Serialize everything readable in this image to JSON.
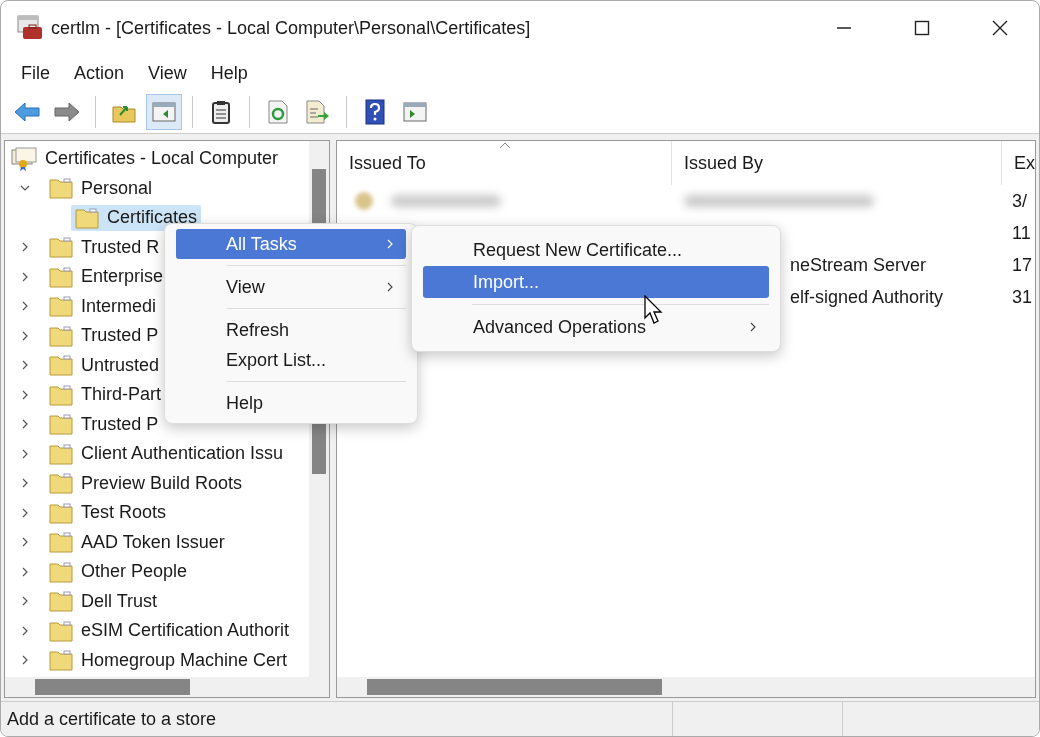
{
  "window": {
    "title": "certlm - [Certificates - Local Computer\\Personal\\Certificates]"
  },
  "menu_bar": [
    "File",
    "Action",
    "View",
    "Help"
  ],
  "toolbar": [
    [
      {
        "kind": "back",
        "pressed": false
      },
      {
        "kind": "forward",
        "pressed": false
      }
    ],
    [
      {
        "kind": "up",
        "pressed": false
      },
      {
        "kind": "tree",
        "pressed": true
      }
    ],
    [
      {
        "kind": "clipboard",
        "pressed": false
      }
    ],
    [
      {
        "kind": "refresh",
        "pressed": false
      },
      {
        "kind": "export",
        "pressed": false
      }
    ],
    [
      {
        "kind": "help",
        "pressed": false
      },
      {
        "kind": "actionpane",
        "pressed": false
      }
    ]
  ],
  "tree": {
    "root": "Certificates - Local Computer",
    "items": [
      {
        "label": "Personal",
        "expanded": true,
        "selected": false,
        "children": [
          {
            "label": "Certificates",
            "selected": true
          }
        ]
      },
      {
        "label": "Trusted R",
        "expanded": false,
        "selected": false
      },
      {
        "label": "Enterprise",
        "expanded": false,
        "selected": false
      },
      {
        "label": "Intermedi",
        "expanded": false,
        "selected": false
      },
      {
        "label": "Trusted P",
        "expanded": false,
        "selected": false
      },
      {
        "label": "Untrusted",
        "expanded": false,
        "selected": false
      },
      {
        "label": "Third-Part",
        "expanded": false,
        "selected": false
      },
      {
        "label": "Trusted P",
        "expanded": false,
        "selected": false
      },
      {
        "label": "Client Authentication Issu",
        "expanded": false,
        "selected": false
      },
      {
        "label": "Preview Build Roots",
        "expanded": false,
        "selected": false
      },
      {
        "label": "Test Roots",
        "expanded": false,
        "selected": false
      },
      {
        "label": "AAD Token Issuer",
        "expanded": false,
        "selected": false
      },
      {
        "label": "Other People",
        "expanded": false,
        "selected": false
      },
      {
        "label": "Dell Trust",
        "expanded": false,
        "selected": false
      },
      {
        "label": "eSIM Certification Authorit",
        "expanded": false,
        "selected": false
      },
      {
        "label": "Homegroup Machine Cert",
        "expanded": false,
        "selected": false
      }
    ]
  },
  "table": {
    "columns": [
      "Issued To",
      "Issued By",
      "Ex"
    ],
    "rows": [
      {
        "blurred": true,
        "column_3": "3/"
      },
      {
        "blurred": false,
        "column_3": "11"
      },
      {
        "blurred": false,
        "covered": true,
        "issued_by": "neStream Server",
        "column_3": "17"
      },
      {
        "blurred": false,
        "covered": true,
        "issued_by": "elf-signed Authority",
        "column_3": "31"
      }
    ]
  },
  "context_menu": {
    "items": [
      {
        "label": "All Tasks",
        "submenu": true,
        "selected": true,
        "separator_after": true
      },
      {
        "label": "View",
        "submenu": true,
        "selected": false,
        "separator_after": true
      },
      {
        "label": "Refresh",
        "submenu": false,
        "selected": false,
        "separator_after": false
      },
      {
        "label": "Export List...",
        "submenu": false,
        "selected": false,
        "separator_after": true
      },
      {
        "label": "Help",
        "submenu": false,
        "selected": false,
        "separator_after": false
      }
    ]
  },
  "submenu": {
    "items": [
      {
        "label": "Request New Certificate...",
        "submenu": false,
        "selected": false,
        "separator_after": false
      },
      {
        "label": "Import...",
        "submenu": false,
        "selected": true,
        "separator_after": true
      },
      {
        "label": "Advanced Operations",
        "submenu": true,
        "selected": false,
        "separator_after": false
      }
    ]
  },
  "status_bar": {
    "text": "Add a certificate to a store"
  }
}
